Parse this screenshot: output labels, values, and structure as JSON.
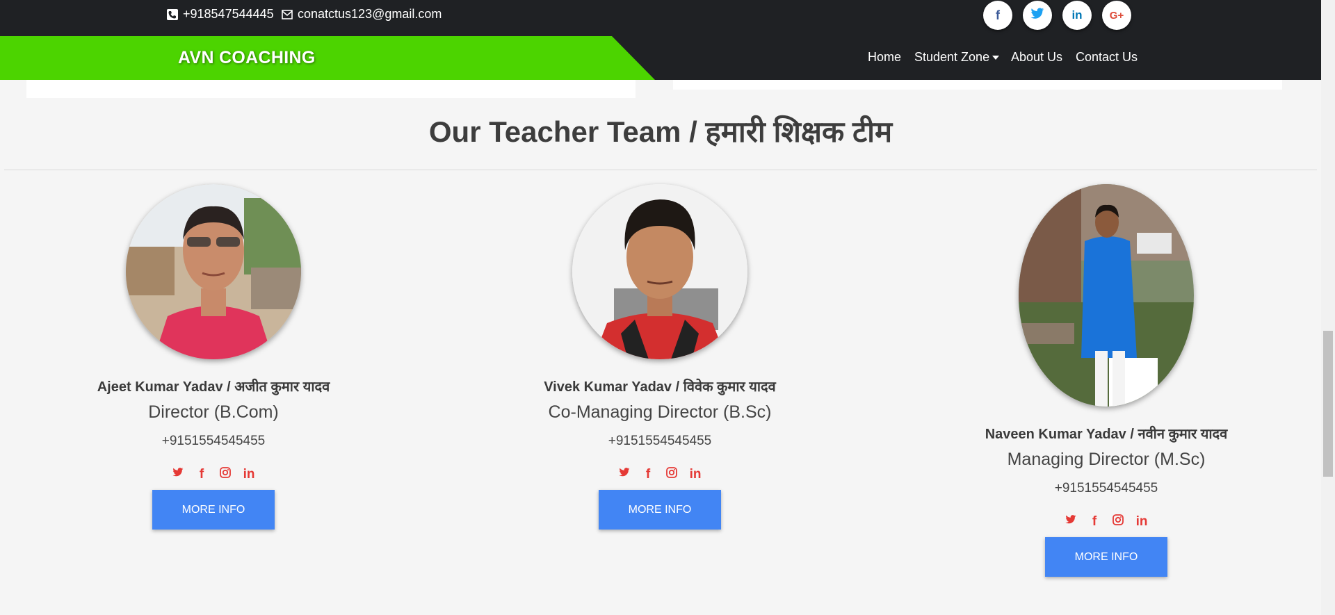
{
  "topbar": {
    "phone": "+918547544445",
    "email": "conatctus123@gmail.com",
    "social": [
      {
        "icon": "facebook-icon",
        "glyph": "f",
        "color": "#3b5998"
      },
      {
        "icon": "twitter-icon",
        "glyph": "🐦",
        "color": "#1da1f2"
      },
      {
        "icon": "linkedin-icon",
        "glyph": "in",
        "color": "#0077b5"
      },
      {
        "icon": "google-plus-icon",
        "glyph": "G+",
        "color": "#dd4b39"
      }
    ]
  },
  "nav": {
    "brand": "AVN COACHING",
    "links": [
      "Home",
      "Student Zone",
      "About Us",
      "Contact Us"
    ]
  },
  "team": {
    "title": "Our Teacher Team / हमारी शिक्षक टीम",
    "members": [
      {
        "name": "Ajeet Kumar Yadav / अजीत कुमार यादव",
        "role": "Director (B.Com)",
        "phone": "+9151554545455",
        "button": "MORE INFO"
      },
      {
        "name": "Vivek Kumar Yadav / विवेक कुमार यादव",
        "role": "Co-Managing Director (B.Sc)",
        "phone": "+9151554545455",
        "button": "MORE INFO"
      },
      {
        "name": "Naveen Kumar Yadav / नवीन कुमार यादव",
        "role": "Managing Director (M.Sc)",
        "phone": "+9151554545455",
        "button": "MORE INFO"
      }
    ]
  },
  "colors": {
    "brand_green": "#4cd400",
    "dark_bar": "#1f2124",
    "button_blue": "#4285f4",
    "social_red": "#e53935"
  }
}
